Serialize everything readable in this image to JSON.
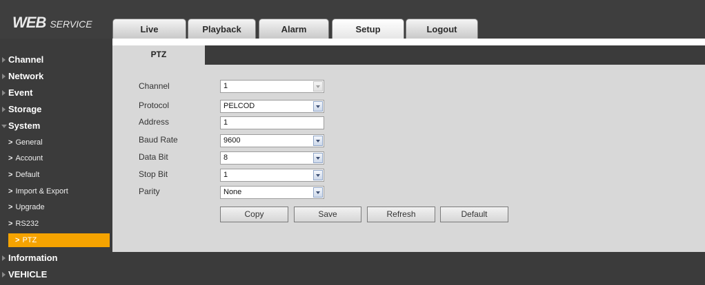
{
  "header": {
    "logo_main": "WEB",
    "logo_sub": "SERVICE",
    "tabs": [
      "Live",
      "Playback",
      "Alarm",
      "Setup",
      "Logout"
    ]
  },
  "sidebar": {
    "top_items": [
      "Channel",
      "Network",
      "Event",
      "Storage",
      "System",
      "Information",
      "VEHICLE"
    ],
    "system_items": [
      "General",
      "Account",
      "Default",
      "Import & Export",
      "Upgrade",
      "RS232",
      "PTZ"
    ],
    "chevron": ">"
  },
  "main": {
    "tab": "PTZ",
    "fields": [
      {
        "label": "Channel",
        "value": "1"
      },
      {
        "label": "Protocol",
        "value": "PELCOD"
      },
      {
        "label": "Address",
        "value": "1"
      },
      {
        "label": "Baud Rate",
        "value": "9600"
      },
      {
        "label": "Data Bit",
        "value": "8"
      },
      {
        "label": "Stop Bit",
        "value": "1"
      },
      {
        "label": "Parity",
        "value": "None"
      }
    ],
    "buttons": [
      "Copy",
      "Save",
      "Refresh",
      "Default"
    ]
  },
  "colors": {
    "header_bg": "#3e3e3e",
    "sidebar_bg": "#3b3b3b",
    "panel_bg": "#d8d8d8",
    "selected": "#f5a300"
  }
}
